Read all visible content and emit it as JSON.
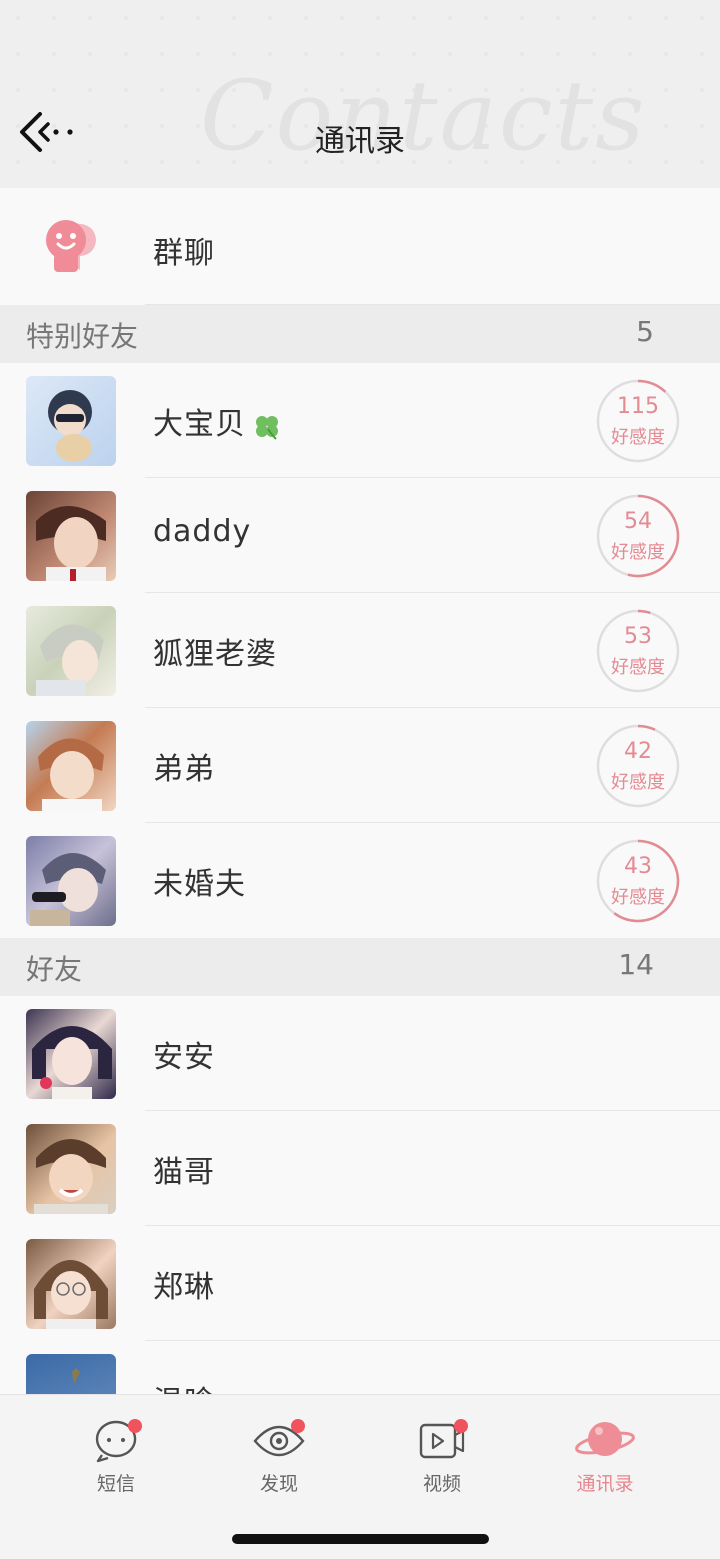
{
  "header": {
    "title": "通讯录",
    "back_icon": "back-arrow-icon"
  },
  "group_chat": {
    "label": "群聊",
    "icon": "group-chat-icon",
    "icon_color": "#f08c98"
  },
  "sections": {
    "special": {
      "label": "特别好友",
      "count": "5",
      "contacts": [
        {
          "name": "大宝贝",
          "badge_icon": "clover-icon",
          "favor": "115",
          "favor_label": "好感度",
          "favor_fraction": 0.12
        },
        {
          "name": "daddy",
          "favor": "54",
          "favor_label": "好感度",
          "favor_fraction": 0.54
        },
        {
          "name": "狐狸老婆",
          "favor": "53",
          "favor_label": "好感度",
          "favor_fraction": 0.05
        },
        {
          "name": "弟弟",
          "favor": "42",
          "favor_label": "好感度",
          "favor_fraction": 0.07
        },
        {
          "name": "未婚夫",
          "favor": "43",
          "favor_label": "好感度",
          "favor_fraction": 0.6
        }
      ]
    },
    "friends": {
      "label": "好友",
      "count": "14",
      "contacts": [
        {
          "name": "安安"
        },
        {
          "name": "猫哥"
        },
        {
          "name": "郑琳"
        },
        {
          "name": "温晗"
        }
      ]
    }
  },
  "tabbar": {
    "tabs": [
      {
        "label": "短信",
        "icon": "message-bubble-icon",
        "has_dot": true
      },
      {
        "label": "发现",
        "icon": "eye-icon",
        "has_dot": true
      },
      {
        "label": "视频",
        "icon": "video-play-icon",
        "has_dot": true
      },
      {
        "label": "通讯录",
        "icon": "planet-icon",
        "active": true
      }
    ]
  },
  "colors": {
    "accent": "#e8868f",
    "favor_ring": "#e38b93",
    "notification_dot": "#f0525e"
  }
}
